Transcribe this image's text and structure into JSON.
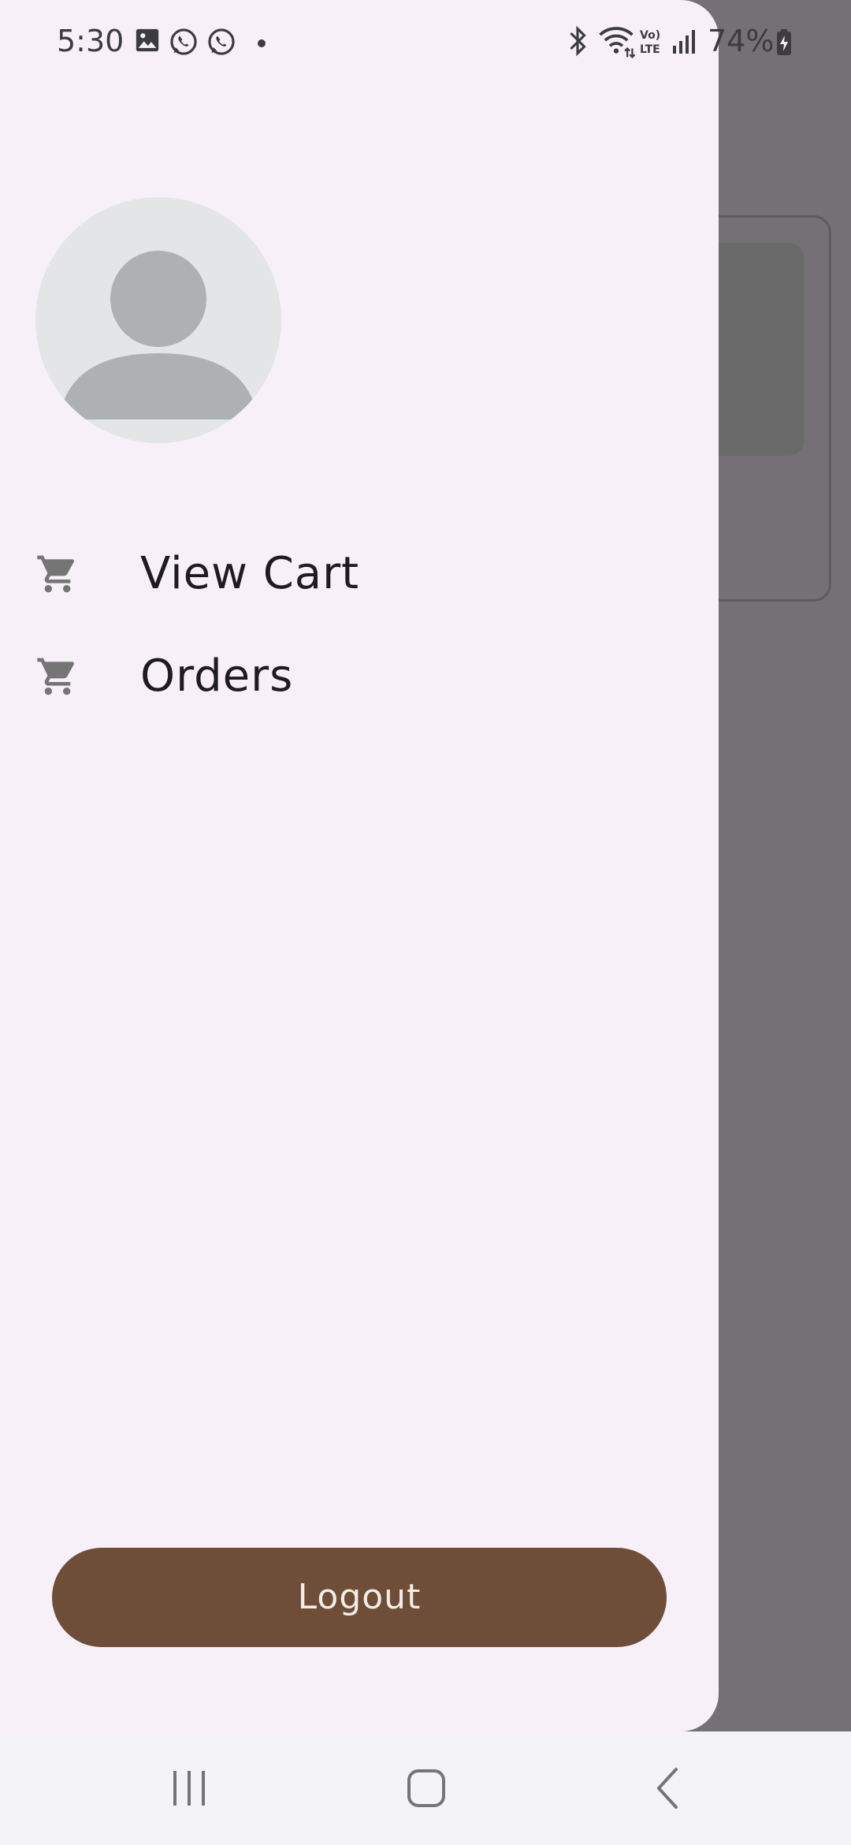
{
  "status_bar": {
    "time": "5:30",
    "battery": "74%",
    "notification_icons": [
      "gallery-icon",
      "whatsapp-icon",
      "whatsapp-icon",
      "dot-icon"
    ],
    "system_icons": [
      "bluetooth-icon",
      "wifi-icon",
      "volte-icon",
      "signal-icon",
      "battery-charging-icon"
    ]
  },
  "drawer": {
    "avatar": "avatar-placeholder-icon",
    "menu": [
      {
        "label": "View Cart",
        "icon": "cart-icon"
      },
      {
        "label": "Orders",
        "icon": "cart-icon"
      }
    ],
    "logout_label": "Logout"
  },
  "nav_bar": {
    "buttons": [
      "recents-icon",
      "home-icon",
      "back-icon"
    ]
  },
  "colors": {
    "drawer_bg": "#f8f0f8",
    "scrim": "#757075",
    "logout_bg": "#6e4e38",
    "logout_text": "#f4ece6",
    "icon_gray": "#757575",
    "text_dark": "#1e1b21"
  }
}
